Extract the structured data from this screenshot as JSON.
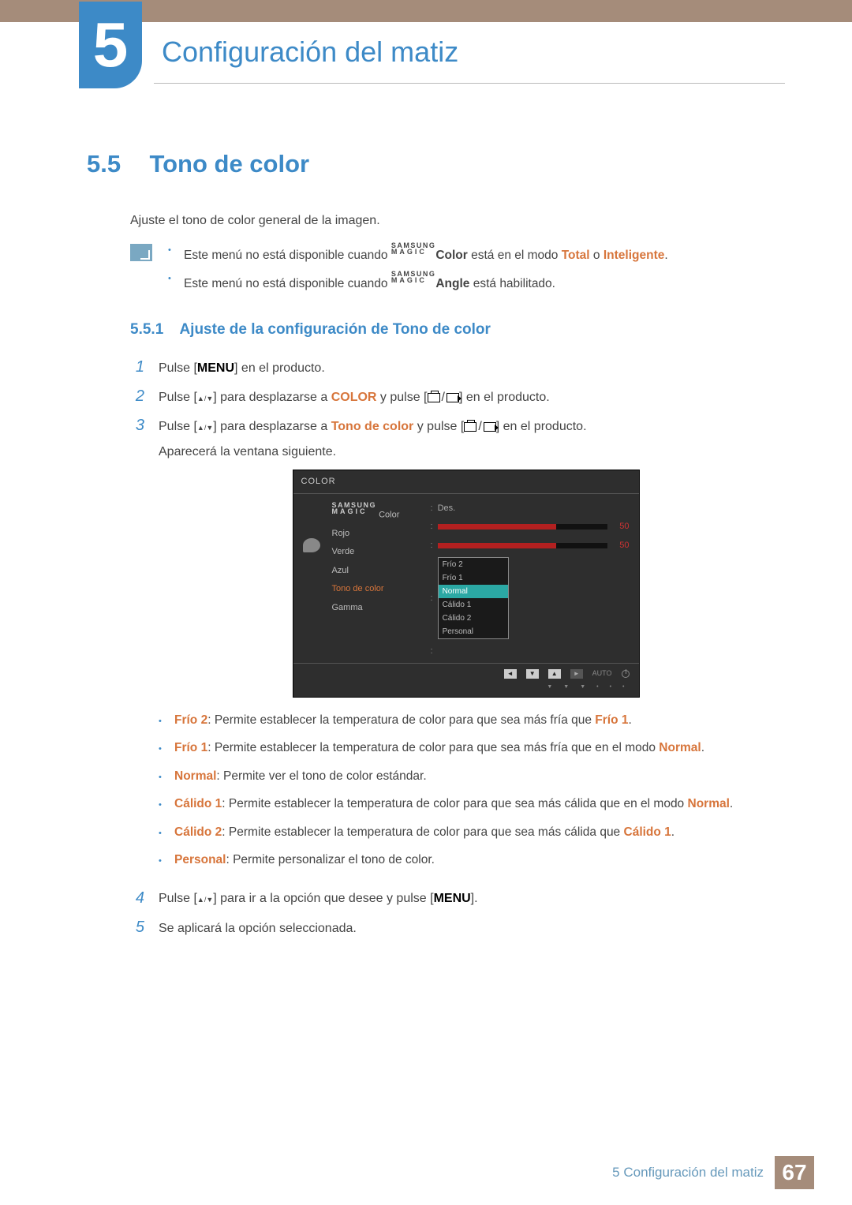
{
  "chapter": {
    "number": "5",
    "title": "Configuración del matiz"
  },
  "section": {
    "number": "5.5",
    "title": "Tono de color"
  },
  "intro": "Ajuste el tono de color general de la imagen.",
  "notes": {
    "line1_a": "Este menú no está disponible cuando ",
    "line1_magic_top": "SAMSUNG",
    "line1_magic_bot": "MAGIC",
    "line1_b": "Color",
    "line1_c": " está en el modo ",
    "line1_total": "Total",
    "line1_or": " o ",
    "line1_intel": "Inteligente",
    "line1_end": ".",
    "line2_a": "Este menú no está disponible cuando ",
    "line2_b": "Angle",
    "line2_c": " está habilitado."
  },
  "subsection": {
    "number": "5.5.1",
    "title": "Ajuste de la configuración de Tono de color"
  },
  "steps": {
    "s1_a": "Pulse [",
    "s1_menu": "MENU",
    "s1_b": "] en el producto.",
    "s2_a": "Pulse [",
    "s2_b": "] para desplazarse a ",
    "s2_color": "COLOR",
    "s2_c": " y pulse [",
    "s2_d": "] en el producto.",
    "s3_a": "Pulse [",
    "s3_b": "] para desplazarse a ",
    "s3_tono": "Tono de color",
    "s3_c": " y pulse [",
    "s3_d": "] en el producto.",
    "s3_e": "Aparecerá la ventana siguiente.",
    "s4_a": "Pulse [",
    "s4_b": "] para ir a la opción que desee y pulse [",
    "s4_menu": "MENU",
    "s4_c": "].",
    "s5": "Se aplicará la opción seleccionada."
  },
  "osd": {
    "title": "COLOR",
    "labels": {
      "magic": "Color",
      "rojo": "Rojo",
      "verde": "Verde",
      "azul": "Azul",
      "tono": "Tono de color",
      "gamma": "Gamma"
    },
    "values": {
      "des": "Des.",
      "rojo": "50",
      "verde": "50"
    },
    "options": [
      "Frío 2",
      "Frío 1",
      "Normal",
      "Cálido 1",
      "Cálido 2",
      "Personal"
    ],
    "selected": "Normal",
    "auto": "AUTO"
  },
  "descriptions": {
    "frio2_lbl": "Frío 2",
    "frio2_txt": ": Permite establecer la temperatura de color para que sea más fría que ",
    "frio2_ref": "Frío 1",
    "frio1_lbl": "Frío 1",
    "frio1_txt": ": Permite establecer la temperatura de color para que sea más fría que en el modo ",
    "frio1_ref": "Normal",
    "normal_lbl": "Normal",
    "normal_txt": ": Permite ver el tono de color estándar.",
    "cal1_lbl": "Cálido 1",
    "cal1_txt": ": Permite establecer la temperatura de color para que sea más cálida que en el modo ",
    "cal1_ref": "Normal",
    "cal2_lbl": "Cálido 2",
    "cal2_txt": ": Permite establecer la temperatura de color para que sea más cálida que ",
    "cal2_ref": "Cálido 1",
    "pers_lbl": "Personal",
    "pers_txt": ": Permite personalizar el tono de color."
  },
  "footer": {
    "crumb_num": "5",
    "crumb_title": "Configuración del matiz",
    "page": "67"
  }
}
